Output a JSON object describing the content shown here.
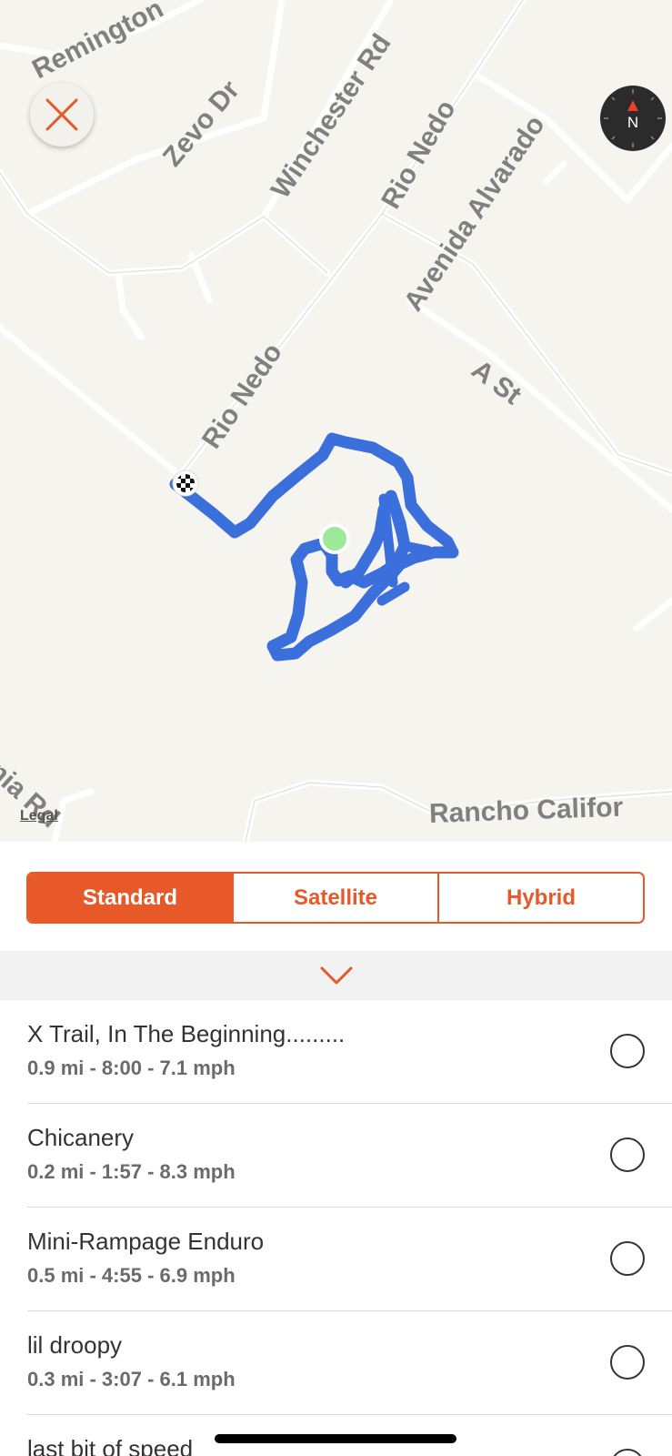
{
  "map": {
    "streets": [
      "Remington",
      "Zevo Dr",
      "Winchester Rd",
      "Rio Nedo",
      "Rio Nedo",
      "Avenida Alvarado",
      "A St",
      "Rio Nedo",
      "Rancho Califor",
      "nia Rd"
    ],
    "legal_label": "Legal",
    "close_icon": "close-icon",
    "compass_label": "N",
    "route_color": "#3a6fdc",
    "start_marker_color": "#9ee89a"
  },
  "map_types": {
    "options": [
      "Standard",
      "Satellite",
      "Hybrid"
    ],
    "selected": "Standard",
    "accent": "#e8592a"
  },
  "collapse_icon": "chevron-down-icon",
  "segments": [
    {
      "title": "X Trail, In The Beginning.........",
      "stats": "0.9 mi - 8:00 - 7.1 mph"
    },
    {
      "title": "Chicanery",
      "stats": "0.2 mi - 1:57 - 8.3 mph"
    },
    {
      "title": "Mini-Rampage Enduro",
      "stats": "0.5 mi - 4:55 - 6.9 mph"
    },
    {
      "title": "lil droopy",
      "stats": "0.3 mi - 3:07 - 6.1 mph"
    },
    {
      "title": "last bit of speed",
      "stats": ""
    }
  ]
}
